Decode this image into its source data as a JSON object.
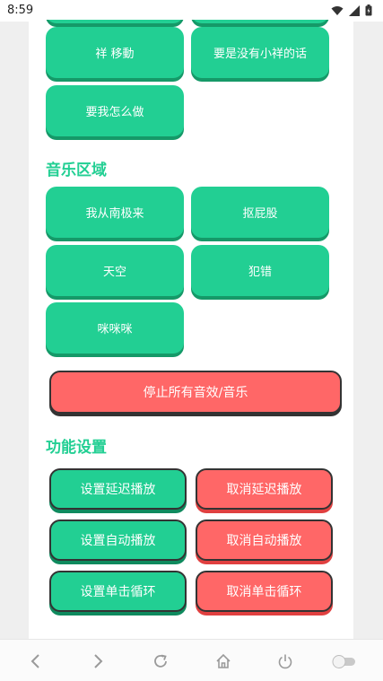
{
  "status": {
    "time": "8:59"
  },
  "top_buttons": [
    {
      "label": "祥 移動"
    },
    {
      "label": "要是没有小祥的话"
    },
    {
      "label": "要我怎么做"
    }
  ],
  "music_section": {
    "title": "音乐区域",
    "buttons": [
      {
        "label": "我从南极来"
      },
      {
        "label": "抠屁股"
      },
      {
        "label": "天空"
      },
      {
        "label": "犯错"
      },
      {
        "label": "咪咪咪"
      }
    ]
  },
  "stop_button": {
    "label": "停止所有音效/音乐"
  },
  "settings_section": {
    "title": "功能设置",
    "buttons": [
      {
        "label": "设置延迟播放"
      },
      {
        "label": "取消延迟播放"
      },
      {
        "label": "设置自动播放"
      },
      {
        "label": "取消自动播放"
      },
      {
        "label": "设置单击循环"
      },
      {
        "label": "取消单击循环"
      }
    ]
  },
  "colors": {
    "green": "#22cf93",
    "red": "#ff6767",
    "text": "#ffffff"
  },
  "nav_icons": [
    "back-icon",
    "forward-icon",
    "reload-icon",
    "home-icon",
    "power-icon",
    "toggle-icon"
  ]
}
